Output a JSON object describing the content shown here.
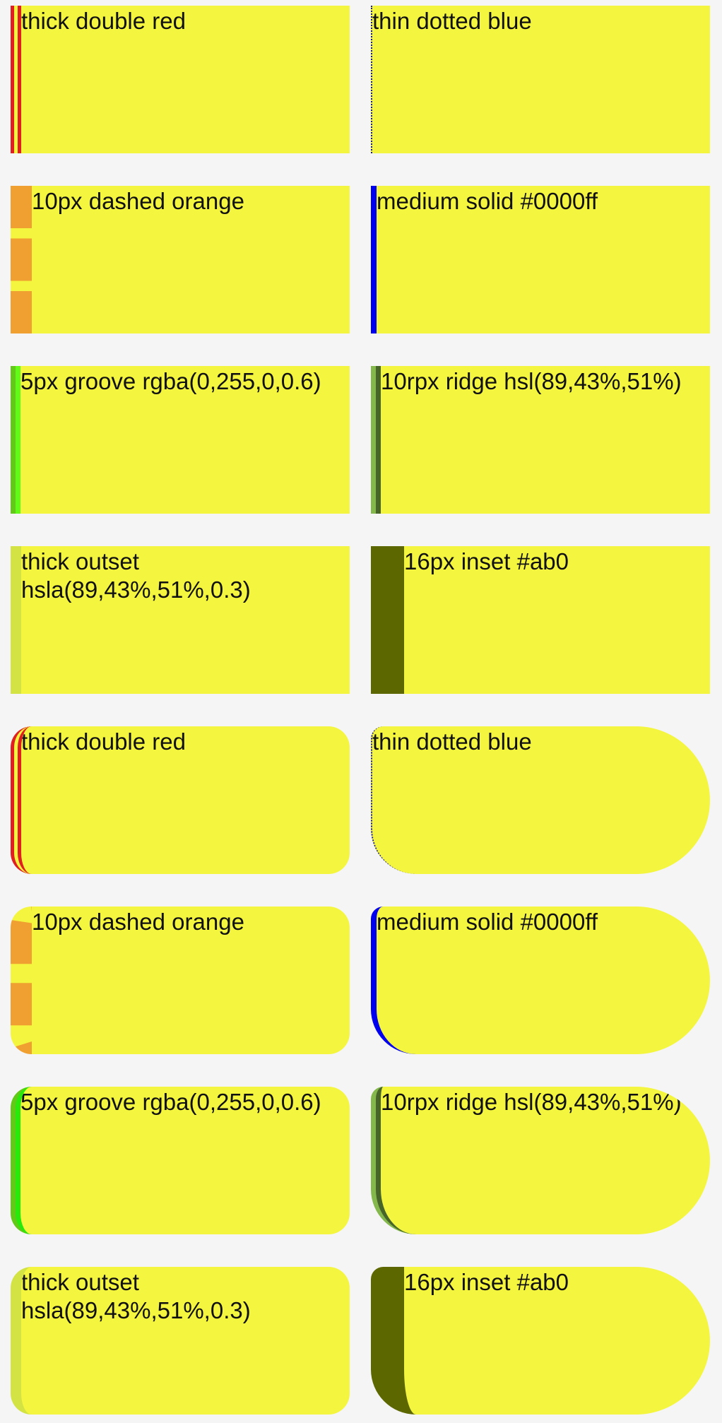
{
  "boxes": [
    {
      "label": "thick double red"
    },
    {
      "label": "thin dotted blue"
    },
    {
      "label": "10px dashed orange"
    },
    {
      "label": "medium solid #0000ff"
    },
    {
      "label": "5px groove rgba(0,255,0,0.6)"
    },
    {
      "label": "10rpx ridge hsl(89,43%,51%)"
    },
    {
      "label": "thick outset hsla(89,43%,51%,0.3)"
    },
    {
      "label": "16px inset #ab0"
    },
    {
      "label": "thick double red"
    },
    {
      "label": "thin dotted blue"
    },
    {
      "label": "10px dashed orange"
    },
    {
      "label": "medium solid #0000ff"
    },
    {
      "label": "5px groove rgba(0,255,0,0.6)"
    },
    {
      "label": "10rpx ridge hsl(89,43%,51%)"
    },
    {
      "label": "thick outset hsla(89,43%,51%,0.3)"
    },
    {
      "label": "16px inset #ab0"
    }
  ],
  "colors": {
    "page_background": "#f5f5f5",
    "box_background": "#f4f53f"
  }
}
